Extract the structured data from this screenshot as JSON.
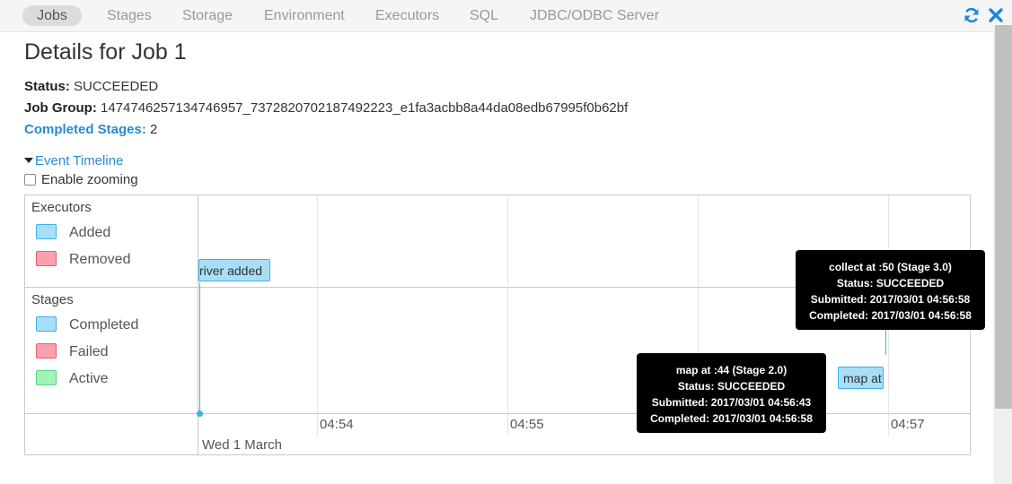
{
  "nav": {
    "tabs": [
      {
        "label": "Jobs"
      },
      {
        "label": "Stages"
      },
      {
        "label": "Storage"
      },
      {
        "label": "Environment"
      },
      {
        "label": "Executors"
      },
      {
        "label": "SQL"
      },
      {
        "label": "JDBC/ODBC Server"
      }
    ],
    "active_tab": "Jobs",
    "icons": [
      "refresh-icon",
      "close-icon"
    ]
  },
  "page": {
    "title": "Details for Job 1",
    "status_label": "Status:",
    "status_value": "SUCCEEDED",
    "job_group_label": "Job Group:",
    "job_group_value": "1474746257134746957_7372820702187492223_e1fa3acbb8a44da08edb67995f0b62bf",
    "completed_stages_label": "Completed Stages:",
    "completed_stages_value": "2",
    "event_timeline_label": "Event Timeline",
    "enable_zooming_label": "Enable zooming",
    "enable_zooming_checked": false
  },
  "timeline": {
    "executors_group": "Executors",
    "executors_legend": [
      {
        "label": "Added",
        "color": "#a8def8",
        "border": "#3eb0e8"
      },
      {
        "label": "Removed",
        "color": "#fba1ad",
        "border": "#e35d6e"
      }
    ],
    "stages_group": "Stages",
    "stages_legend": [
      {
        "label": "Completed",
        "color": "#a8def8",
        "border": "#3eb0e8"
      },
      {
        "label": "Failed",
        "color": "#fba1ad",
        "border": "#e35d6e"
      },
      {
        "label": "Active",
        "color": "#a5f2b8",
        "border": "#52d67a"
      }
    ],
    "axis_ticks": [
      "04:54",
      "04:55",
      "04:57"
    ],
    "axis_date": "Wed 1 March",
    "driver_bar_label": "river added",
    "stage_bar_label": "map at",
    "tooltips": [
      {
        "title": "collect at :50 (Stage 3.0)",
        "status": "Status: SUCCEEDED",
        "submitted": "Submitted: 2017/03/01 04:56:58",
        "completed": "Completed: 2017/03/01 04:56:58"
      },
      {
        "title": "map at :44 (Stage 2.0)",
        "status": "Status: SUCCEEDED",
        "submitted": "Submitted: 2017/03/01 04:56:43",
        "completed": "Completed: 2017/03/01 04:56:58"
      }
    ]
  }
}
